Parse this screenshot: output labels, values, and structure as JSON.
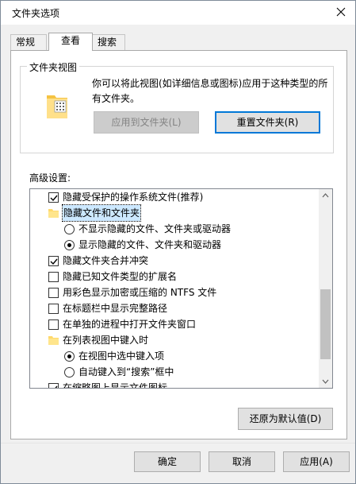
{
  "window": {
    "title": "文件夹选项"
  },
  "tabs": [
    {
      "label": "常规",
      "active": false
    },
    {
      "label": "查看",
      "active": true
    },
    {
      "label": "搜索",
      "active": false
    }
  ],
  "folder_views": {
    "legend": "文件夹视图",
    "description": "你可以将此视图(如详细信息或图标)应用于这种类型的所有文件夹。",
    "apply_button": "应用到文件夹(L)",
    "reset_button": "重置文件夹(R)"
  },
  "advanced": {
    "label": "高级设置:",
    "items": [
      {
        "type": "checkbox",
        "checked": true,
        "indent": 0,
        "label": "隐藏受保护的操作系统文件(推荐)"
      },
      {
        "type": "folder",
        "indent": 0,
        "label": "隐藏文件和文件夹",
        "selected": true
      },
      {
        "type": "radio",
        "checked": false,
        "indent": 1,
        "label": "不显示隐藏的文件、文件夹或驱动器"
      },
      {
        "type": "radio",
        "checked": true,
        "indent": 1,
        "label": "显示隐藏的文件、文件夹和驱动器"
      },
      {
        "type": "checkbox",
        "checked": true,
        "indent": 0,
        "label": "隐藏文件夹合并冲突"
      },
      {
        "type": "checkbox",
        "checked": false,
        "indent": 0,
        "label": "隐藏已知文件类型的扩展名"
      },
      {
        "type": "checkbox",
        "checked": false,
        "indent": 0,
        "label": "用彩色显示加密或压缩的 NTFS 文件"
      },
      {
        "type": "checkbox",
        "checked": false,
        "indent": 0,
        "label": "在标题栏中显示完整路径"
      },
      {
        "type": "checkbox",
        "checked": false,
        "indent": 0,
        "label": "在单独的进程中打开文件夹窗口"
      },
      {
        "type": "folder",
        "indent": 0,
        "label": "在列表视图中键入时"
      },
      {
        "type": "radio",
        "checked": true,
        "indent": 1,
        "label": "在视图中选中键入项"
      },
      {
        "type": "radio",
        "checked": false,
        "indent": 1,
        "label": "自动键入到“搜索”框中"
      },
      {
        "type": "checkbox",
        "checked": true,
        "indent": 0,
        "label": "在缩略图上显示文件图标"
      }
    ],
    "restore_button": "还原为默认值(D)"
  },
  "footer": {
    "ok": "确定",
    "cancel": "取消",
    "apply": "应用(A)"
  },
  "colors": {
    "accent": "#0078d7",
    "folder": "#ffd96b"
  }
}
